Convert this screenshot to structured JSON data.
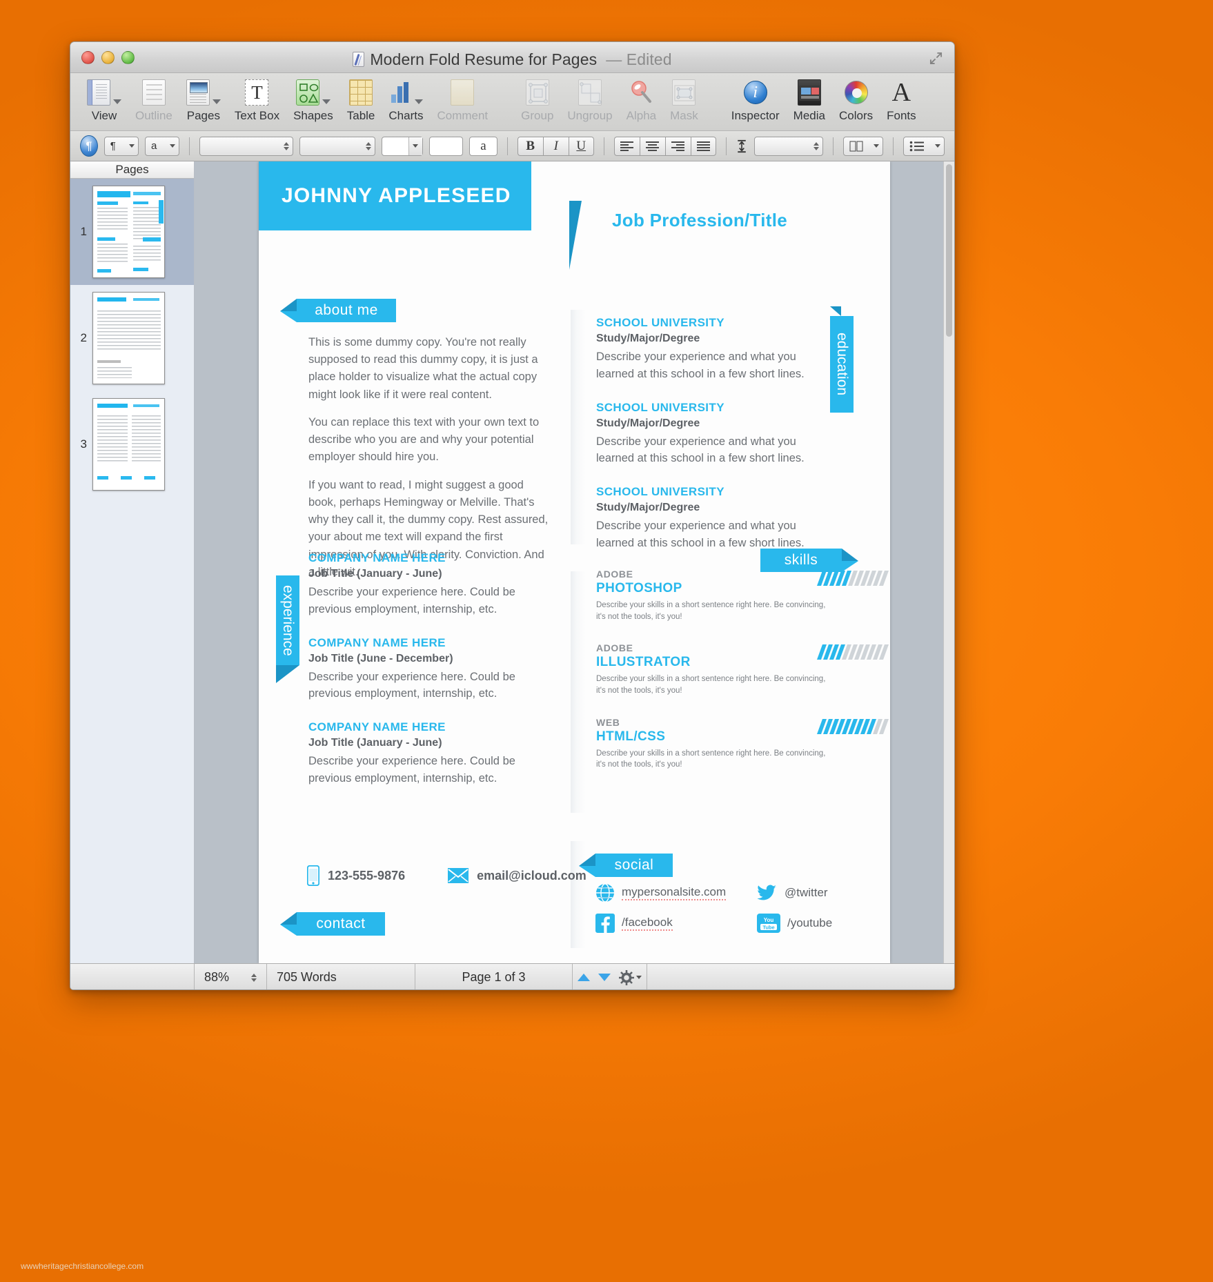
{
  "window": {
    "title": "Modern Fold Resume for Pages",
    "title_suffix": "— Edited",
    "doc_icon": "pages-doc-icon"
  },
  "toolbar": {
    "items": [
      {
        "label": "View",
        "icon": "view-icon",
        "caret": true,
        "dim": false
      },
      {
        "label": "Outline",
        "icon": "outline-icon",
        "caret": false,
        "dim": true
      },
      {
        "label": "Pages",
        "icon": "pages-icon",
        "caret": true,
        "dim": false
      },
      {
        "label": "Text Box",
        "icon": "text-box-icon",
        "caret": false,
        "dim": false
      },
      {
        "label": "Shapes",
        "icon": "shapes-icon",
        "caret": true,
        "dim": false
      },
      {
        "label": "Table",
        "icon": "table-icon",
        "caret": false,
        "dim": false
      },
      {
        "label": "Charts",
        "icon": "charts-icon",
        "caret": true,
        "dim": false
      },
      {
        "label": "Comment",
        "icon": "comment-icon",
        "caret": false,
        "dim": true
      },
      {
        "label": "Group",
        "icon": "group-icon",
        "caret": false,
        "dim": true
      },
      {
        "label": "Ungroup",
        "icon": "ungroup-icon",
        "caret": false,
        "dim": true
      },
      {
        "label": "Alpha",
        "icon": "alpha-icon",
        "caret": false,
        "dim": true
      },
      {
        "label": "Mask",
        "icon": "mask-icon",
        "caret": false,
        "dim": true
      },
      {
        "label": "Inspector",
        "icon": "inspector-icon",
        "caret": false,
        "dim": false
      },
      {
        "label": "Media",
        "icon": "media-icon",
        "caret": false,
        "dim": false
      },
      {
        "label": "Colors",
        "icon": "colors-icon",
        "caret": false,
        "dim": false
      },
      {
        "label": "Fonts",
        "icon": "fonts-icon",
        "caret": false,
        "dim": false
      }
    ]
  },
  "format_bar": {
    "style_button": "paragraph-styles-toggle",
    "paragraph_label": "¶",
    "character_label": "a",
    "font_family_value": "",
    "font_style_value": "",
    "font_size_value": "",
    "text_color_swatch": "#ffffff",
    "char_style_label": "a",
    "bold": "B",
    "italic": "I",
    "underline": "U",
    "align": [
      "align-left",
      "align-center",
      "align-right",
      "align-justify"
    ],
    "line_spacing_icon": "line-spacing-icon",
    "line_spacing_value": "",
    "columns_icon": "columns-icon",
    "list_icon": "list-icon"
  },
  "sidebar": {
    "title": "Pages",
    "thumbnails": [
      {
        "number": "1",
        "selected": true
      },
      {
        "number": "2",
        "selected": false
      },
      {
        "number": "3",
        "selected": false
      }
    ]
  },
  "status_bar": {
    "zoom": "88%",
    "word_count": "705 Words",
    "page_indicator": "Page 1 of 3",
    "nav_up": "previous-page",
    "nav_down": "next-page",
    "settings": "view-settings"
  },
  "resume": {
    "name": "JOHNNY APPLESEED",
    "job_title": "Job Profession/Title",
    "about": {
      "tag": "about me",
      "paragraphs": [
        "This is some dummy copy. You're not really supposed to read this dummy copy, it is just a place holder to visualize what the actual copy might look like if it were real content.",
        "You can replace this text with your own text to describe who you are and why your potential employer should hire you.",
        "If you want to read, I might suggest a good book, perhaps Hemingway or Melville. That's why they call it, the dummy copy. Rest assured, your about me text will expand the first impression of you. With clarity. Conviction. And a little wit."
      ]
    },
    "education": {
      "tag": "education",
      "entries": [
        {
          "school": "SCHOOL UNIVERSITY",
          "degree": "Study/Major/Degree",
          "desc": "Describe your experience and what you learned at this school in a few short lines."
        },
        {
          "school": "SCHOOL UNIVERSITY",
          "degree": "Study/Major/Degree",
          "desc": "Describe your experience and what you learned at this school in a few short lines."
        },
        {
          "school": "SCHOOL UNIVERSITY",
          "degree": "Study/Major/Degree",
          "desc": "Describe your experience and what you learned at this school in a few short lines."
        }
      ]
    },
    "experience": {
      "tag": "experience",
      "entries": [
        {
          "company": "COMPANY NAME HERE",
          "role": "Job Title (January - June)",
          "desc": "Describe your experience here. Could be previous employment, internship, etc."
        },
        {
          "company": "COMPANY NAME HERE",
          "role": "Job Title (June - December)",
          "desc": "Describe your experience here. Could be previous employment, internship, etc."
        },
        {
          "company": "COMPANY NAME HERE",
          "role": "Job Title (January - June)",
          "desc": "Describe your experience here. Could be previous employment, internship, etc."
        }
      ]
    },
    "skills": {
      "tag": "skills",
      "entries": [
        {
          "brand": "ADOBE",
          "name": "PHOTOSHOP",
          "desc": "Describe your skills in a short sentence right here. Be convincing, it's not the tools, it's you!",
          "filled": 5,
          "total": 11
        },
        {
          "brand": "ADOBE",
          "name": "ILLUSTRATOR",
          "desc": "Describe your skills in a short sentence right here. Be convincing, it's not the tools, it's you!",
          "filled": 4,
          "total": 11
        },
        {
          "brand": "WEB",
          "name": "HTML/CSS",
          "desc": "Describe your skills in a short sentence right here. Be convincing, it's not the tools, it's you!",
          "filled": 9,
          "total": 11
        }
      ]
    },
    "contact": {
      "tag": "contact",
      "phone": "123-555-9876",
      "email": "email@icloud.com",
      "phone_icon": "phone-icon",
      "email_icon": "envelope-icon"
    },
    "social": {
      "tag": "social",
      "entries": [
        {
          "label": "mypersonalsite.com",
          "icon": "globe-icon",
          "dotted": true
        },
        {
          "label": "@twitter",
          "icon": "twitter-icon",
          "dotted": false
        },
        {
          "label": "/facebook",
          "icon": "facebook-icon",
          "dotted": true
        },
        {
          "label": "/youtube",
          "icon": "youtube-icon",
          "dotted": false
        }
      ]
    },
    "accent_color": "#29B8EC"
  },
  "watermark": "wwwheritagechristiancollege.com"
}
